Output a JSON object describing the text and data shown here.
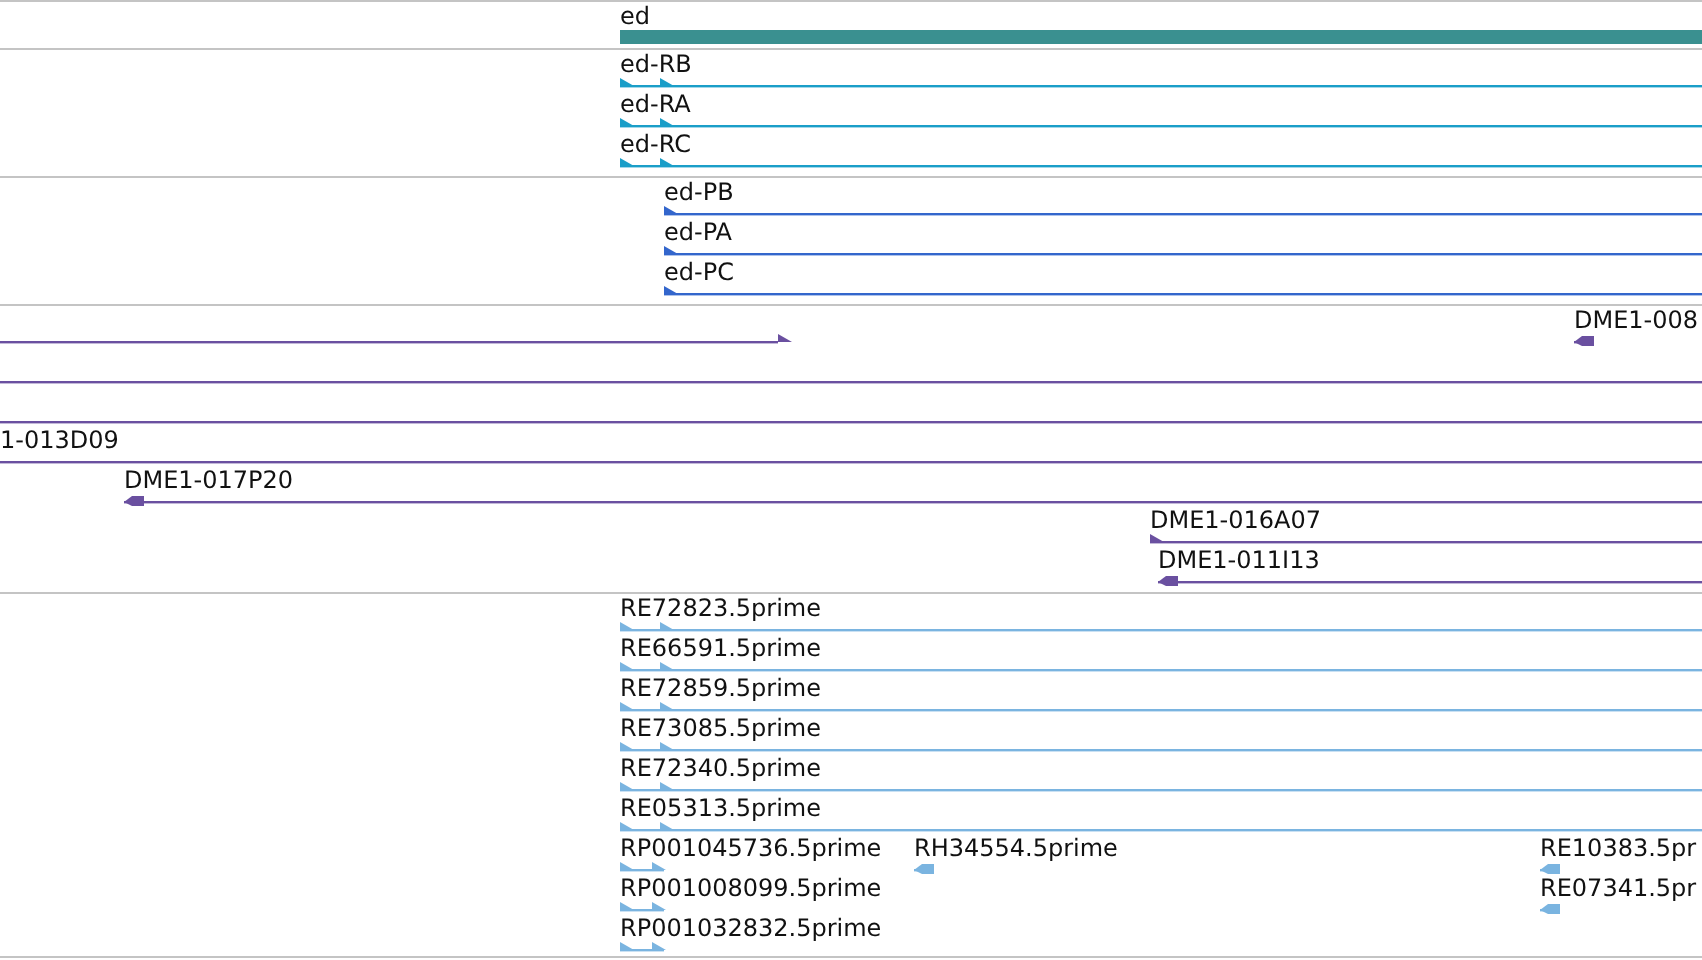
{
  "tracks": [
    {
      "kind": "gene",
      "color": "#3a9090",
      "features": [
        {
          "label": "ed"
        }
      ]
    },
    {
      "kind": "transcript",
      "color": "#1a9ec8",
      "features": [
        {
          "label": "ed-RB",
          "kind": "forward"
        },
        {
          "label": "ed-RA",
          "kind": "forward"
        },
        {
          "label": "ed-RC",
          "kind": "forward"
        }
      ]
    },
    {
      "kind": "protein",
      "color": "#3366cc",
      "features": [
        {
          "label": "ed-PB",
          "kind": "forward"
        },
        {
          "label": "ed-PA",
          "kind": "forward"
        },
        {
          "label": "ed-PC",
          "kind": "forward"
        }
      ]
    },
    {
      "kind": "clone",
      "color": "#6a50a0",
      "features": [
        {
          "kind": "forward"
        },
        {
          "label": "DME1-008",
          "kind": "reverse"
        },
        {
          "kind": "line"
        },
        {
          "kind": "line"
        },
        {
          "label": "1-013D09",
          "kind": "line"
        },
        {
          "label": "DME1-017P20",
          "kind": "reverse"
        },
        {
          "label": "DME1-016A07",
          "kind": "forward"
        },
        {
          "label": "DME1-011I13",
          "kind": "reverse"
        }
      ]
    },
    {
      "kind": "est",
      "color": "#7ab4e0",
      "features": [
        {
          "label": "RE72823.5prime",
          "kind": "forward"
        },
        {
          "label": "RE66591.5prime",
          "kind": "forward"
        },
        {
          "label": "RE72859.5prime",
          "kind": "forward"
        },
        {
          "label": "RE73085.5prime",
          "kind": "forward"
        },
        {
          "label": "RE72340.5prime",
          "kind": "forward"
        },
        {
          "label": "RE05313.5prime",
          "kind": "forward"
        },
        {
          "label": "RP001045736.5prime",
          "kind": "forward"
        },
        {
          "label": "RH34554.5prime",
          "kind": "reverse"
        },
        {
          "label": "RE10383.5pr",
          "kind": "reverse"
        },
        {
          "label": "RP001008099.5prime",
          "kind": "forward"
        },
        {
          "label": "RE07341.5pr",
          "kind": "reverse"
        },
        {
          "label": "RP001032832.5prime",
          "kind": "forward"
        }
      ]
    }
  ]
}
